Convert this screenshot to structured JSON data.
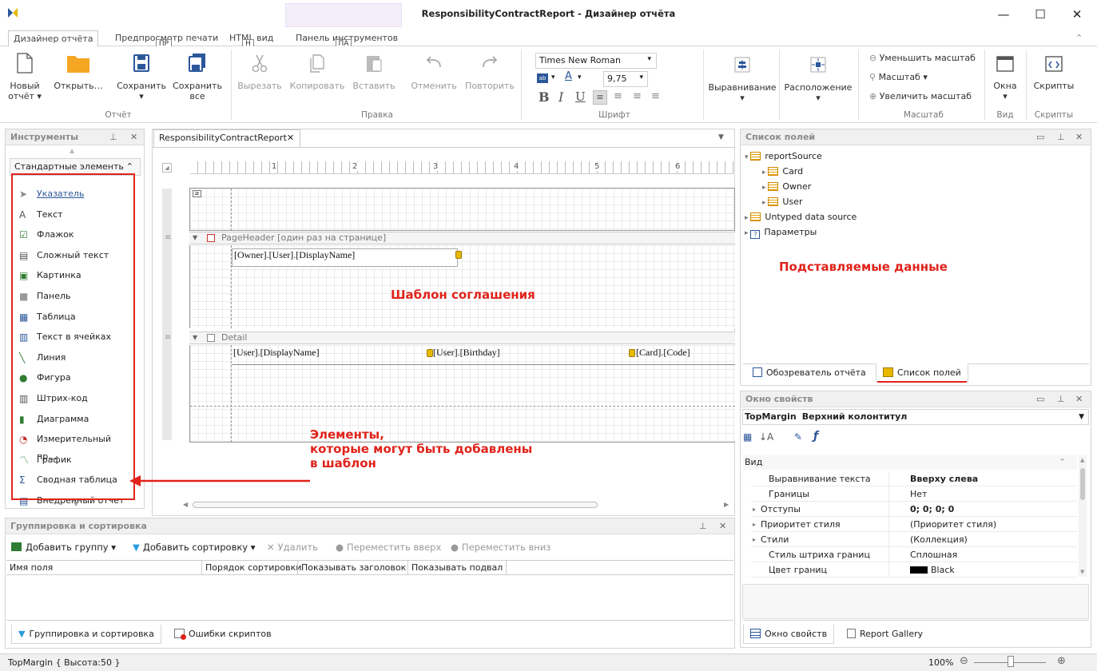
{
  "window": {
    "title": "ResponsibilityContractReport - Дизайнер отчёта",
    "minimize": "—",
    "maximize": "☐",
    "close": "✕"
  },
  "ribbon_tabs": [
    {
      "label": "Дизайнер отчёта",
      "keytip": "Д"
    },
    {
      "label": "Предпросмотр печати",
      "keytip": "ПР"
    },
    {
      "label": "HTML вид",
      "keytip": "Н"
    },
    {
      "label": "Панель инструментов",
      "keytip": "ПА"
    }
  ],
  "ribbon": {
    "new_label": "Новый",
    "new_label2": "отчёт ▾",
    "open_label": "Открыть…",
    "save_label": "Сохранить",
    "save_arrow": "▾",
    "saveall_label": "Сохранить",
    "saveall_label2": "все",
    "group_report": "Отчёт",
    "cut_label": "Вырезать",
    "copy_label": "Копировать",
    "paste_label": "Вставить",
    "undo_label": "Отменить",
    "redo_label": "Повторить",
    "group_edit": "Правка",
    "font_name": "Times New Roman",
    "font_size": "9,75",
    "group_font": "Шрифт",
    "bold": "B",
    "italic": "I",
    "underline": "U",
    "align_label": "Выравнивание",
    "layout_label": "Расположение",
    "arrow": "▾",
    "zoom_out": "Уменьшить масштаб",
    "zoom": "Масштаб ▾",
    "zoom_in": "Увеличить масштаб",
    "group_zoom": "Масштаб",
    "windows_label": "Окна",
    "group_view": "Вид",
    "scripts_label": "Скрипты",
    "group_scripts": "Скрипты"
  },
  "tools_panel": {
    "title": "Инструменты",
    "category": "Стандартные элементь",
    "items": [
      {
        "label": "Указатель",
        "icon": "pointer-icon"
      },
      {
        "label": "Текст",
        "icon": "text-icon"
      },
      {
        "label": "Флажок",
        "icon": "checkbox-icon"
      },
      {
        "label": "Сложный текст",
        "icon": "richtext-icon"
      },
      {
        "label": "Картинка",
        "icon": "picture-icon"
      },
      {
        "label": "Панель",
        "icon": "panel-icon"
      },
      {
        "label": "Таблица",
        "icon": "table-icon"
      },
      {
        "label": "Текст в ячейках",
        "icon": "celltext-icon"
      },
      {
        "label": "Линия",
        "icon": "line-icon"
      },
      {
        "label": "Фигура",
        "icon": "shape-icon"
      },
      {
        "label": "Штрих-код",
        "icon": "barcode-icon"
      },
      {
        "label": "Диаграмма",
        "icon": "chart-icon"
      },
      {
        "label": "Измерительный пр…",
        "icon": "gauge-icon"
      },
      {
        "label": "График",
        "icon": "sparkline-icon"
      },
      {
        "label": "Сводная таблица",
        "icon": "pivot-icon"
      },
      {
        "label": "Внедренный отчет",
        "icon": "subreport-icon"
      }
    ]
  },
  "designer": {
    "tab": "ResponsibilityContractReport",
    "ruler_marks": [
      "1",
      "2",
      "3",
      "4",
      "5",
      "6"
    ],
    "band_pageheader": "PageHeader [один раз на странице]",
    "band_detail": "Detail",
    "field_owner": "[Owner].[User].[DisplayName]",
    "field_user_name": "[User].[DisplayName]",
    "field_birthday": "[User].[Birthday]",
    "field_card_code": "[Card].[Code]",
    "annotation_template": "Шаблон соглашения"
  },
  "annotations": {
    "elements_line1": "Элементы,",
    "elements_line2": "которые могут быть добавлены",
    "elements_line3": "в шаблон",
    "fields": "Подставляемые данные"
  },
  "fields_panel": {
    "title": "Список полей",
    "tree": [
      {
        "label": "reportSource",
        "level": 0
      },
      {
        "label": "Card",
        "level": 1
      },
      {
        "label": "Owner",
        "level": 1
      },
      {
        "label": "User",
        "level": 1
      },
      {
        "label": "Untyped data source",
        "level": 0
      },
      {
        "label": "Параметры",
        "level": 0
      }
    ],
    "tab_explorer": "Обозреватель отчёта",
    "tab_fields": "Список полей"
  },
  "properties_panel": {
    "title": "Окно свойств",
    "selected_name": "TopMargin",
    "selected_desc": "Верхний колонтитул",
    "category": "Вид",
    "rows": [
      {
        "name": "Выравнивание текста",
        "value": "Вверху слева",
        "bold": true,
        "expand": false
      },
      {
        "name": "Границы",
        "value": "Нет",
        "bold": false,
        "expand": false
      },
      {
        "name": "Отступы",
        "value": "0; 0; 0; 0",
        "bold": true,
        "expand": true
      },
      {
        "name": "Приоритет стиля",
        "value": "(Приоритет стиля)",
        "bold": false,
        "expand": true
      },
      {
        "name": "Стили",
        "value": "(Коллекция)",
        "bold": false,
        "expand": true
      },
      {
        "name": "Стиль штриха границ",
        "value": "Сплошная",
        "bold": false,
        "expand": false
      },
      {
        "name": "Цвет границ",
        "value": "Black",
        "bold": false,
        "expand": false
      }
    ],
    "tab_props": "Окно свойств",
    "tab_gallery": "Report Gallery"
  },
  "grouping_panel": {
    "title": "Группировка и сортировка",
    "add_group": "Добавить группу ▾",
    "add_sort": "Добавить сортировку ▾",
    "delete": "Удалить",
    "move_up": "Переместить вверх",
    "move_down": "Переместить вниз",
    "columns": [
      "Имя поля",
      "Порядок сортировки",
      "Показывать заголовок",
      "Показывать подвал"
    ],
    "tab_grouping": "Группировка и сортировка",
    "tab_errors": "Ошибки скриптов"
  },
  "status": {
    "left": "TopMargin { Высота:50 }",
    "zoom": "100%"
  },
  "colors": {
    "accent": "#2b579a",
    "annotation": "#e0231b",
    "folder": "#f5a623"
  }
}
